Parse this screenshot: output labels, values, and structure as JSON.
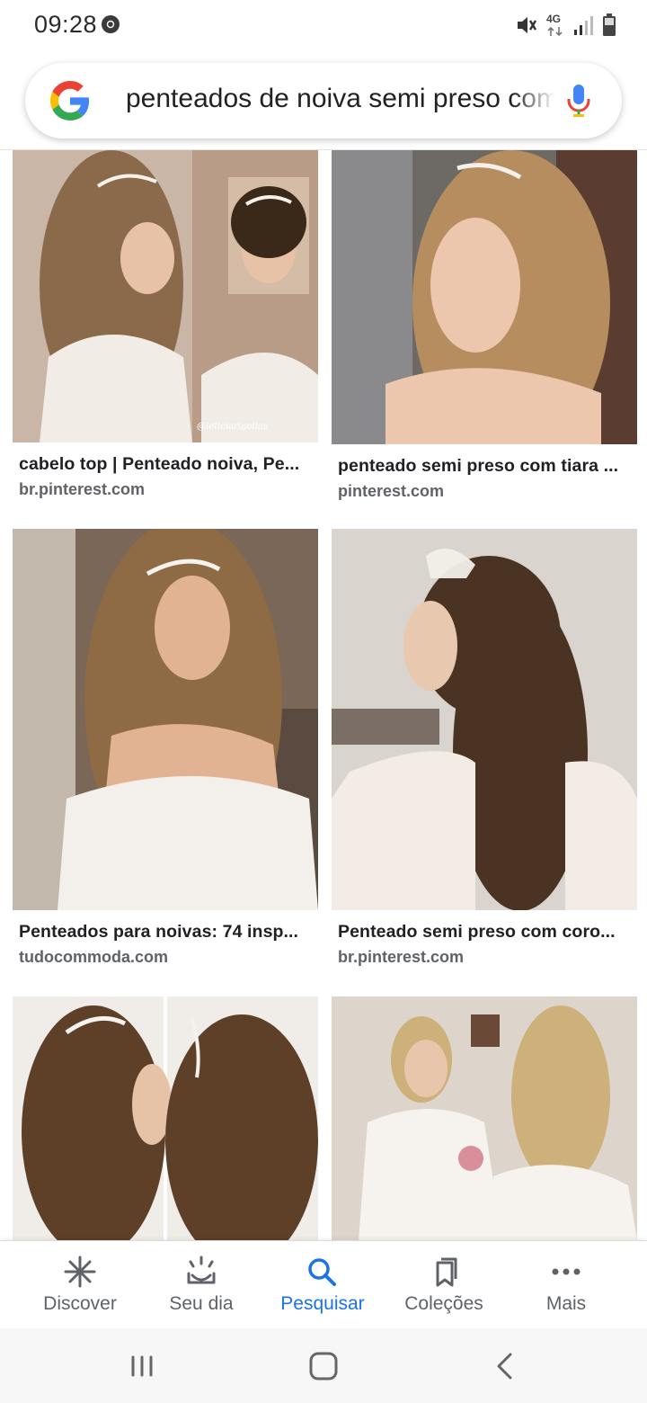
{
  "status_bar": {
    "time": "09:28",
    "network": "4G"
  },
  "search": {
    "query": "penteados de noiva semi preso com tiara"
  },
  "results": [
    {
      "caption": "cabelo top | Penteado noiva, Pe...",
      "domain": "br.pinterest.com",
      "watermark": "@leticiarigolias",
      "colors": {
        "bg": "#c9b6a6",
        "hair": "#8a6a4a",
        "skin": "#e8c2a6",
        "dress": "#f1ece6"
      }
    },
    {
      "caption": "penteado semi preso com tiara ...",
      "domain": "pinterest.com",
      "colors": {
        "bg": "#6d6a66",
        "hair": "#b68d5e",
        "skin": "#edc7ad",
        "dress": "#eadfd2"
      }
    },
    {
      "caption": "Penteados para noivas: 74 insp...",
      "domain": "tudocommoda.com",
      "colors": {
        "bg": "#7a6758",
        "hair": "#8e6a45",
        "skin": "#e2b393",
        "dress": "#f3f0eb"
      }
    },
    {
      "caption": "Penteado semi preso com coro...",
      "domain": "br.pinterest.com",
      "colors": {
        "bg": "#d9d4ce",
        "hair": "#4a3322",
        "skin": "#e8c8ae",
        "dress": "#f2ece4"
      }
    },
    {
      "caption": "",
      "domain": "",
      "colors": {
        "bg": "#f0ece8",
        "hair": "#5e3f28",
        "skin": "#e6c3a7",
        "dress": "#f5f1ec"
      }
    },
    {
      "caption": "",
      "domain": "",
      "colors": {
        "bg": "#ddd5cc",
        "hair": "#cdb07a",
        "skin": "#e8c6ab",
        "dress": "#f6f2ee"
      }
    }
  ],
  "bottom_nav": {
    "items": [
      {
        "label": "Discover",
        "icon": "asterisk-icon"
      },
      {
        "label": "Seu dia",
        "icon": "sunrise-icon"
      },
      {
        "label": "Pesquisar",
        "icon": "search-icon",
        "active": true
      },
      {
        "label": "Coleções",
        "icon": "collections-icon"
      },
      {
        "label": "Mais",
        "icon": "more-dots-icon"
      }
    ]
  },
  "system_nav": {
    "buttons": [
      "recent-apps",
      "home",
      "back"
    ]
  },
  "colors": {
    "accent": "#1a73e8",
    "text_primary": "#202124",
    "text_secondary": "#5f6368"
  }
}
